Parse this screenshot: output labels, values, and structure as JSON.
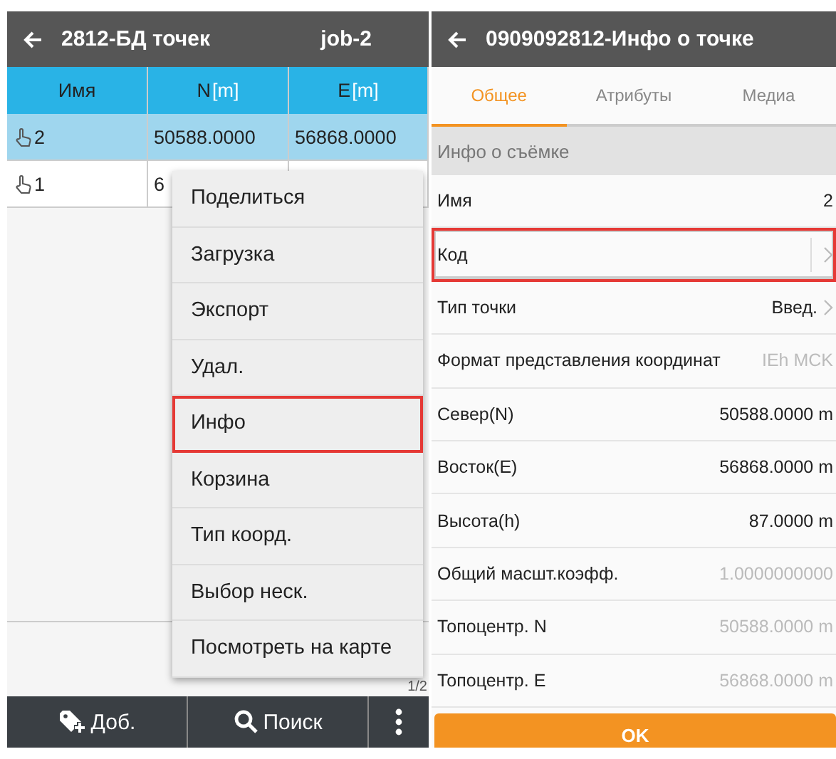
{
  "points_screen": {
    "title": "2812-БД точек",
    "job": "job-2",
    "table": {
      "columns": [
        {
          "name": "Имя"
        },
        {
          "name": "N",
          "unit": "[m]"
        },
        {
          "name": "E",
          "unit": "[m]"
        }
      ],
      "rows": [
        {
          "selected": true,
          "cells": [
            "2",
            "50588.0000",
            "56868.0000"
          ]
        },
        {
          "selected": false,
          "cells": [
            "1",
            "6",
            ""
          ]
        }
      ]
    },
    "page": "1/2",
    "menu": [
      {
        "label": "Поделиться",
        "highlighted": false
      },
      {
        "label": "Загрузка",
        "highlighted": false
      },
      {
        "label": "Экспорт",
        "highlighted": false
      },
      {
        "label": "Удал.",
        "highlighted": false
      },
      {
        "label": "Инфо",
        "highlighted": true
      },
      {
        "label": "Корзина",
        "highlighted": false
      },
      {
        "label": "Тип коорд.",
        "highlighted": false
      },
      {
        "label": "Выбор неск.",
        "highlighted": false
      },
      {
        "label": "Посмотреть на карте",
        "highlighted": false
      }
    ],
    "bottom_bar": [
      {
        "kind": "add",
        "label": "Доб."
      },
      {
        "kind": "search",
        "label": "Поиск"
      },
      {
        "kind": "more"
      }
    ]
  },
  "info_screen": {
    "title": "0909092812-Инфо о точке",
    "tabs": [
      {
        "label": "Общее",
        "selected": true
      },
      {
        "label": "Атрибуты",
        "selected": false
      },
      {
        "label": "Медиа",
        "selected": false
      }
    ],
    "section": "Инфо о съёмке",
    "fields": [
      {
        "label": "Имя",
        "value": "2",
        "kind": "plain",
        "highlighted": false
      },
      {
        "label": "Код",
        "kind": "link",
        "highlighted": true
      },
      {
        "label": "Тип точки",
        "value": "Введ.",
        "kind": "link",
        "highlighted": false
      },
      {
        "label": "Формат представления координат",
        "value": "IEh MCK",
        "kind": "plain",
        "disabled": true,
        "highlighted": false
      },
      {
        "label": "Север(N)",
        "value": "50588.0000 m",
        "kind": "plain",
        "highlighted": false
      },
      {
        "label": "Восток(E)",
        "value": "56868.0000 m",
        "kind": "plain",
        "highlighted": false
      },
      {
        "label": "Высота(h)",
        "value": "87.0000 m",
        "kind": "plain",
        "highlighted": false
      },
      {
        "label": "Общий масшт.коэфф.",
        "value": "1.0000000000",
        "kind": "plain",
        "disabled": true,
        "highlighted": false
      },
      {
        "label": "Топоцентр. N",
        "value": "50588.0000 m",
        "kind": "plain",
        "disabled": true,
        "highlighted": false
      },
      {
        "label": "Топоцентр. E",
        "value": "56868.0000 m",
        "kind": "plain",
        "disabled": true,
        "highlighted": false
      }
    ],
    "ok": "OK"
  }
}
